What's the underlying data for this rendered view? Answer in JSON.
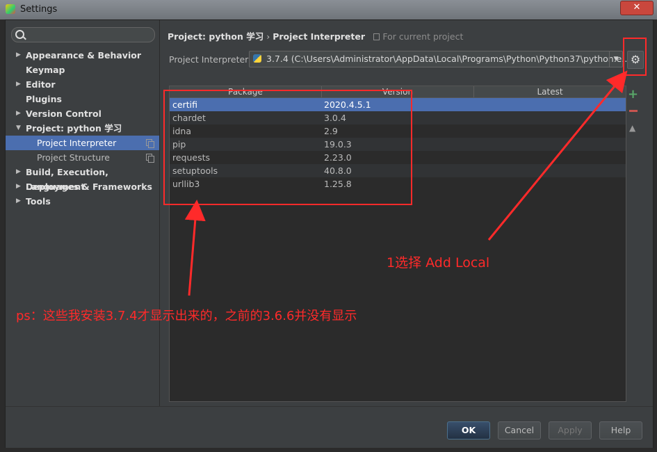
{
  "window": {
    "title": "Settings",
    "close_label": "✕"
  },
  "sidebar": {
    "search": {
      "placeholder": "",
      "value": ""
    },
    "items": [
      {
        "label": "Appearance & Behavior",
        "expandable": true
      },
      {
        "label": "Keymap",
        "expandable": false
      },
      {
        "label": "Editor",
        "expandable": true
      },
      {
        "label": "Plugins",
        "expandable": false
      },
      {
        "label": "Version Control",
        "expandable": true
      },
      {
        "label": "Project: python 学习",
        "expandable": true,
        "expanded": true
      },
      {
        "label": "Project Interpreter",
        "sub": true,
        "selected": true
      },
      {
        "label": "Project Structure",
        "sub": true
      },
      {
        "label": "Build, Execution, Deployment",
        "expandable": true
      },
      {
        "label": "Languages & Frameworks",
        "expandable": true
      },
      {
        "label": "Tools",
        "expandable": true
      }
    ]
  },
  "breadcrumb": {
    "project": "Project: python 学习",
    "separator": "›",
    "page": "Project Interpreter",
    "note": "For current project"
  },
  "interpreter": {
    "label": "Project Interpreter:",
    "value": "3.7.4 (C:\\Users\\Administrator\\AppData\\Local\\Programs\\Python\\Python37\\python.e..."
  },
  "table": {
    "columns": [
      "Package",
      "Version",
      "Latest"
    ],
    "rows": [
      {
        "package": "certifi",
        "version": "2020.4.5.1",
        "latest": ""
      },
      {
        "package": "chardet",
        "version": "3.0.4",
        "latest": ""
      },
      {
        "package": "idna",
        "version": "2.9",
        "latest": ""
      },
      {
        "package": "pip",
        "version": "19.0.3",
        "latest": ""
      },
      {
        "package": "requests",
        "version": "2.23.0",
        "latest": ""
      },
      {
        "package": "setuptools",
        "version": "40.8.0",
        "latest": ""
      },
      {
        "package": "urllib3",
        "version": "1.25.8",
        "latest": ""
      }
    ],
    "selected_row": 0
  },
  "tools": {
    "add": "+",
    "upgrade": "▲"
  },
  "footer": {
    "ok": "OK",
    "cancel": "Cancel",
    "apply": "Apply",
    "help": "Help"
  },
  "annotations": {
    "add_local": "1选择 Add Local",
    "ps_note": "ps：这些我安装3.7.4才显示出来的，之前的3.6.6并没有显示"
  },
  "colors": {
    "selection": "#4b6eaf",
    "annotation": "#ff2a2a",
    "background": "#3c3f41"
  }
}
